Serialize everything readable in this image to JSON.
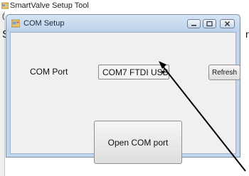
{
  "app": {
    "title": "SmartValve Setup Tool",
    "partial_letter_top": "(",
    "partial_letter_left": "S",
    "partial_letter_right": "n"
  },
  "dialog": {
    "title": "COM Setup",
    "com_port_label": "COM Port",
    "com_port_value": "COM7 FTDI USB",
    "refresh_label": "Refresh",
    "open_button_label": "Open COM port"
  },
  "colors": {
    "dialog_frame": "#bfd6ee",
    "client_bg": "#f0f0f0"
  }
}
